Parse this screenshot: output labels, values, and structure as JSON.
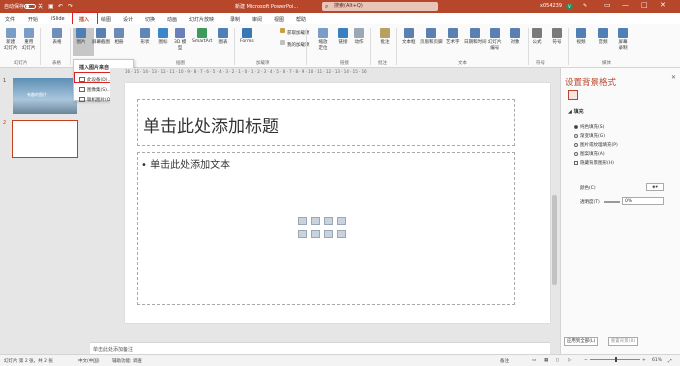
{
  "titlebar": {
    "autosave_label": "自动保存",
    "autosave_state": "关",
    "doc_title": "新建 Microsoft PowerPoi...",
    "search_placeholder": "搜索(Alt+Q)",
    "user_name": "x054239",
    "avatar_initial": "V",
    "brand_color": "#b7472a"
  },
  "tabs": [
    "文件",
    "开始",
    "iSlide",
    "插入",
    "绘图",
    "设计",
    "切换",
    "动画",
    "幻灯片放映",
    "录制",
    "审阅",
    "视图",
    "帮助"
  ],
  "active_tab": "插入",
  "share_label": "共享",
  "comments_label": "批注",
  "ribbon": {
    "buttons": [
      {
        "label": "新建\n幻灯片",
        "icon": "new-slide-icon"
      },
      {
        "label": "重用\n幻灯片",
        "icon": "reuse-slides-icon"
      },
      {
        "label": "表格",
        "icon": "table-icon"
      },
      {
        "label": "图片",
        "icon": "picture-icon"
      },
      {
        "label": "屏幕截图",
        "icon": "screenshot-icon"
      },
      {
        "label": "相册",
        "icon": "album-icon"
      },
      {
        "label": "形状",
        "icon": "shapes-icon"
      },
      {
        "label": "图标",
        "icon": "icons-icon"
      },
      {
        "label": "3D 模\n型",
        "icon": "3d-model-icon"
      },
      {
        "label": "SmartArt",
        "icon": "smartart-icon"
      },
      {
        "label": "图表",
        "icon": "chart-icon"
      },
      {
        "label": "Forms",
        "icon": "forms-icon"
      },
      {
        "label": "获取加载项",
        "icon": "get-addins-icon"
      },
      {
        "label": "我的加载项",
        "icon": "my-addins-icon"
      },
      {
        "label": "缩放\n定位",
        "icon": "zoom-icon"
      },
      {
        "label": "链接",
        "icon": "link-icon"
      },
      {
        "label": "动作",
        "icon": "action-icon"
      },
      {
        "label": "批注",
        "icon": "comment-icon"
      },
      {
        "label": "文本框",
        "icon": "textbox-icon"
      },
      {
        "label": "页眉和页脚",
        "icon": "header-footer-icon"
      },
      {
        "label": "艺术字",
        "icon": "wordart-icon"
      },
      {
        "label": "日期和时间",
        "icon": "datetime-icon"
      },
      {
        "label": "幻灯片\n编号",
        "icon": "slide-number-icon"
      },
      {
        "label": "对象",
        "icon": "object-icon"
      },
      {
        "label": "公式",
        "icon": "equation-icon"
      },
      {
        "label": "符号",
        "icon": "symbol-icon"
      },
      {
        "label": "视频",
        "icon": "video-icon"
      },
      {
        "label": "音频",
        "icon": "audio-icon"
      },
      {
        "label": "屏幕\n录制",
        "icon": "screen-record-icon"
      }
    ],
    "groups": [
      "幻灯片",
      "表格",
      "插图",
      "加载项",
      "链接",
      "批注",
      "文本",
      "符号",
      "媒体"
    ]
  },
  "dropdown": {
    "header": "插入图片来自",
    "items": [
      "此设备(D)...",
      "图像集(S)...",
      "联机图片(O)..."
    ]
  },
  "thumbnails": [
    {
      "number": "1",
      "caption": "有趣的图片"
    },
    {
      "number": "2",
      "caption": ""
    }
  ],
  "slide": {
    "title_placeholder": "单击此处添加标题",
    "body_placeholder": "• 单击此处添加文本"
  },
  "notes_placeholder": "单击此处添加备注",
  "format_pane": {
    "title": "设置背景格式",
    "section": "填充",
    "options": [
      {
        "label": "纯色填充(S)",
        "type": "radio",
        "checked": true
      },
      {
        "label": "渐变填充(G)",
        "type": "radio",
        "checked": false
      },
      {
        "label": "图片或纹理填充(P)",
        "type": "radio",
        "checked": false
      },
      {
        "label": "图案填充(A)",
        "type": "radio",
        "checked": false
      },
      {
        "label": "隐藏背景图形(H)",
        "type": "checkbox",
        "checked": false
      }
    ],
    "color_label": "颜色(C)",
    "transparency_label": "透明度(T)",
    "transparency_value": "0%",
    "apply_all": "应用到全部(L)",
    "reset": "重置背景(B)"
  },
  "statusbar": {
    "slide_info": "幻灯片 第 2 张，共 2 张",
    "language": "中文(中国)",
    "accessibility": "辅助功能: 调查",
    "notes": "备注",
    "zoom": "61%"
  }
}
